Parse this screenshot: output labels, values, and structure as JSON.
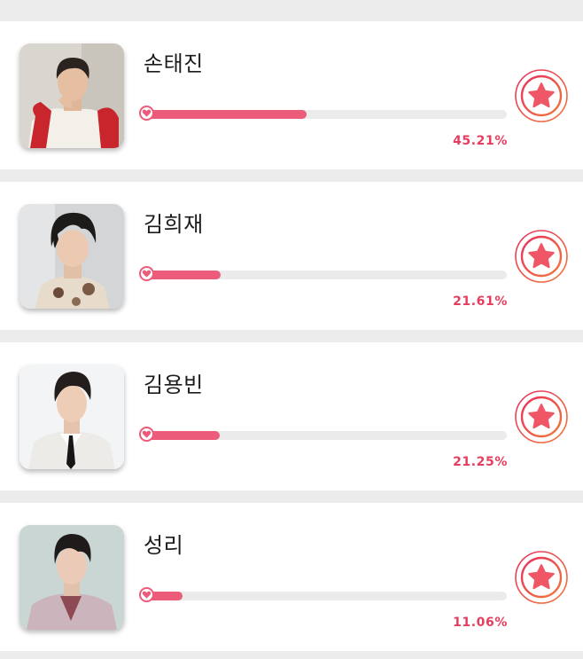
{
  "accent_color": "#ec5b79",
  "percent_color": "#e63d5f",
  "candidates": [
    {
      "name": "손태진",
      "percent_label": "45.21%",
      "share": 45.21,
      "photo": "portrait-red-sweater"
    },
    {
      "name": "김희재",
      "percent_label": "21.61%",
      "share": 21.61,
      "photo": "portrait-floral-shirt"
    },
    {
      "name": "김용빈",
      "percent_label": "21.25%",
      "share": 21.25,
      "photo": "portrait-white-suit"
    },
    {
      "name": "성리",
      "percent_label": "11.06%",
      "share": 11.06,
      "photo": "portrait-pink-suit"
    }
  ],
  "icons": {
    "vote": "star-vote-icon",
    "knob": "heart-icon"
  }
}
